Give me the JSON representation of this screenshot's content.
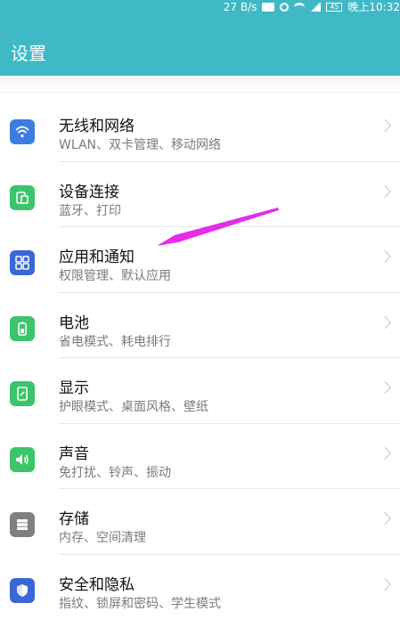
{
  "status_bar": {
    "speed": "27 B/s",
    "battery": "45",
    "time": "晚上10:32"
  },
  "header": {
    "title": "设置"
  },
  "items": [
    {
      "title": "无线和网络",
      "subtitle": "WLAN、双卡管理、移动网络",
      "icon": "wifi-icon",
      "color": "#3b7de0"
    },
    {
      "title": "设备连接",
      "subtitle": "蓝牙、打印",
      "icon": "device-connect-icon",
      "color": "#3cc469"
    },
    {
      "title": "应用和通知",
      "subtitle": "权限管理、默认应用",
      "icon": "apps-grid-icon",
      "color": "#3b67d6"
    },
    {
      "title": "电池",
      "subtitle": "省电模式、耗电排行",
      "icon": "battery-icon",
      "color": "#3cc469"
    },
    {
      "title": "显示",
      "subtitle": "护眼模式、桌面风格、壁纸",
      "icon": "display-icon",
      "color": "#3cc469"
    },
    {
      "title": "声音",
      "subtitle": "免打扰、铃声、振动",
      "icon": "volume-icon",
      "color": "#3cc469"
    },
    {
      "title": "存储",
      "subtitle": "内存、空间清理",
      "icon": "storage-icon",
      "color": "#7f7f7f"
    },
    {
      "title": "安全和隐私",
      "subtitle": "指纹、锁屏和密码、学生模式",
      "icon": "shield-icon",
      "color": "#3b67d6"
    }
  ],
  "annotation_color": "#e22ee8"
}
